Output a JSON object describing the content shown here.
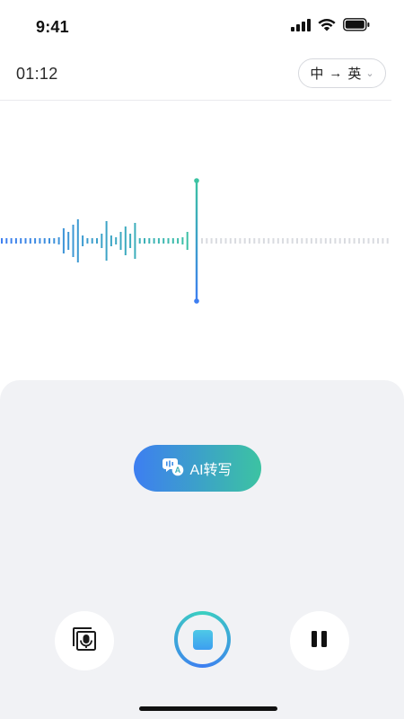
{
  "status_bar": {
    "time": "9:41"
  },
  "header": {
    "timer": "01:12",
    "lang_source": "中",
    "lang_arrow": "→",
    "lang_target": "英",
    "lang_chevron": "⌄"
  },
  "waveform": {
    "colors": {
      "start": "#3d7ef1",
      "end": "#3cc3a2",
      "future": "#d9dbe0",
      "playhead_top": "#3cc3a2",
      "playhead_bottom": "#3d7ef1"
    }
  },
  "ai_button": {
    "label": "AI转写"
  },
  "controls": {
    "left_icon": "mic-record-icon",
    "center_icon": "stop-icon",
    "right_icon": "pause-icon"
  },
  "colors": {
    "accent_blue": "#3d7ef1",
    "accent_green": "#3cc3a2",
    "panel_bg": "#f1f2f5"
  }
}
